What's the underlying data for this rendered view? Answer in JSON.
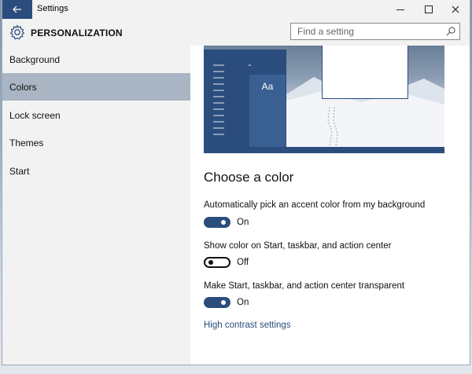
{
  "window": {
    "title": "Settings",
    "back_icon": "back-arrow-icon"
  },
  "header": {
    "title": "PERSONALIZATION",
    "icon": "gear-icon",
    "search_placeholder": "Find a setting"
  },
  "sidebar": {
    "items": [
      {
        "label": "Background"
      },
      {
        "label": "Colors",
        "active": true
      },
      {
        "label": "Lock screen"
      },
      {
        "label": "Themes"
      },
      {
        "label": "Start"
      }
    ]
  },
  "preview": {
    "sample_text": "Aa",
    "accent_color": "#2b4d7d"
  },
  "main": {
    "section_title": "Choose a color",
    "options": [
      {
        "label": "Automatically pick an accent color from my background",
        "state": "On"
      },
      {
        "label": "Show color on Start, taskbar, and action center",
        "state": "Off"
      },
      {
        "label": "Make Start, taskbar, and action center transparent",
        "state": "On"
      }
    ],
    "link": "High contrast settings"
  }
}
